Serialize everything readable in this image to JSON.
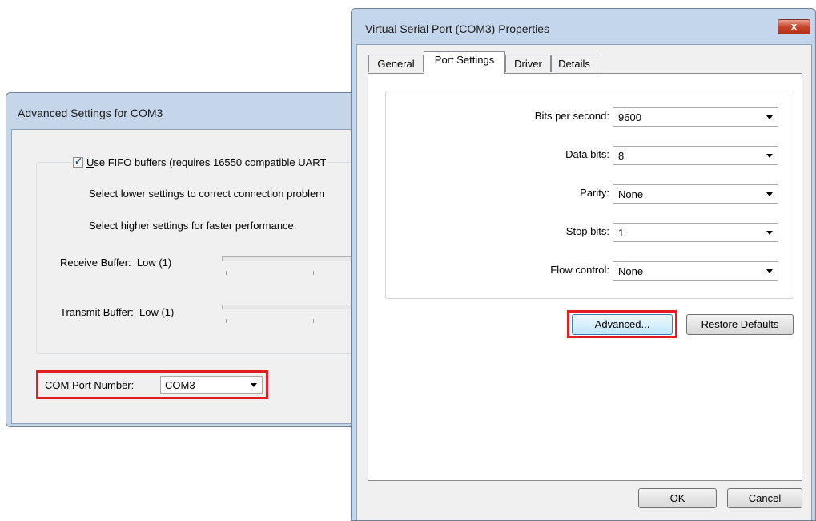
{
  "advanced_window": {
    "title": "Advanced Settings for COM3",
    "fifo_checkbox": {
      "checked": true,
      "label": "Use FIFO buffers (requires 16550 compatible UART"
    },
    "hint_lower": "Select lower settings to correct connection problem",
    "hint_higher": "Select higher settings for faster performance.",
    "receive_buffer": {
      "label": "Receive Buffer:",
      "value": "Low (1)"
    },
    "transmit_buffer": {
      "label": "Transmit Buffer:",
      "value": "Low (1)"
    },
    "com_port": {
      "label": "COM Port Number:",
      "value": "COM3"
    }
  },
  "properties_window": {
    "title": "Virtual Serial Port (COM3) Properties",
    "close_symbol": "x",
    "tabs": [
      {
        "label": "General",
        "active": false
      },
      {
        "label": "Port Settings",
        "active": true
      },
      {
        "label": "Driver",
        "active": false
      },
      {
        "label": "Details",
        "active": false
      }
    ],
    "fields": {
      "bits_per_second": {
        "label": "Bits per second:",
        "value": "9600"
      },
      "data_bits": {
        "label": "Data bits:",
        "value": "8"
      },
      "parity": {
        "label": "Parity:",
        "value": "None"
      },
      "stop_bits": {
        "label": "Stop bits:",
        "value": "1"
      },
      "flow_control": {
        "label": "Flow control:",
        "value": "None"
      }
    },
    "buttons": {
      "advanced": "Advanced...",
      "restore_defaults": "Restore Defaults",
      "ok": "OK",
      "cancel": "Cancel"
    }
  },
  "colors": {
    "highlight": "#e31d24",
    "title_bar": "#c4d6eb",
    "close_button": "#c7452b"
  }
}
